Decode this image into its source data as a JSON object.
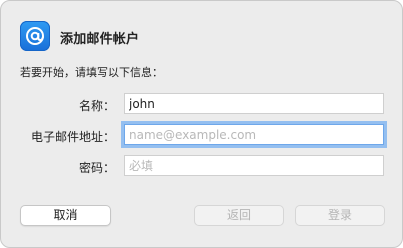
{
  "dialog": {
    "title": "添加邮件帐户",
    "instruction": "若要开始，请填写以下信息：",
    "icon": "at-sign-icon"
  },
  "form": {
    "name_label": "名称：",
    "name_value": "john",
    "email_label": "电子邮件地址：",
    "email_value": "",
    "email_placeholder": "name@example.com",
    "password_label": "密码：",
    "password_value": "",
    "password_placeholder": "必填"
  },
  "buttons": {
    "cancel_label": "取消",
    "back_label": "返回",
    "login_label": "登录"
  },
  "colors": {
    "accent": "#1a6fd8",
    "focus_ring": "#94bff0"
  }
}
